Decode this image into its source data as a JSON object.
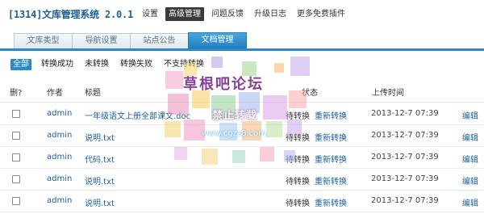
{
  "app": {
    "title": "[1314]文库管理系统 2.0.1"
  },
  "topnav": [
    "设置",
    "高级管理",
    "问题反馈",
    "升级日志",
    "更多免费插件"
  ],
  "tabs": [
    "文库类型",
    "导航设置",
    "站点公告",
    "文档管理"
  ],
  "filters": [
    "全部",
    "转换成功",
    "未转换",
    "转换失败",
    "不支持转换"
  ],
  "table": {
    "headers": {
      "delete": "删?",
      "author": "作者",
      "title": "标题",
      "status": "状态",
      "time": "上传时间"
    },
    "rows": [
      {
        "author": "admin",
        "title": "一年级语文上册全部课文.doc",
        "status": "待转换",
        "action": "重新转换",
        "time": "2013-12-7 07:39",
        "edit": "编辑"
      },
      {
        "author": "admin",
        "title": "说明.txt",
        "status": "待转换",
        "action": "重新转换",
        "time": "2013-12-7 07:39",
        "edit": "编辑"
      },
      {
        "author": "admin",
        "title": "代码.txt",
        "status": "待转换",
        "action": "重新转换",
        "time": "2013-12-7 07:39",
        "edit": "编辑"
      },
      {
        "author": "admin",
        "title": "说明.txt",
        "status": "待转换",
        "action": "重新转换",
        "time": "2013-12-7 07:39",
        "edit": "编辑"
      },
      {
        "author": "admin",
        "title": "说明.txt",
        "status": "待转换",
        "action": "重新转换",
        "time": "2013-12-7 07:39",
        "edit": "编辑"
      }
    ]
  },
  "watermark": {
    "title": "草根吧论坛",
    "subtitle": "禁止转载",
    "url": "www.cgzz8.com"
  },
  "colors": {
    "accent": "#2a8ac8",
    "link": "#1e5f9a",
    "watermark": "#7b2d8b"
  }
}
